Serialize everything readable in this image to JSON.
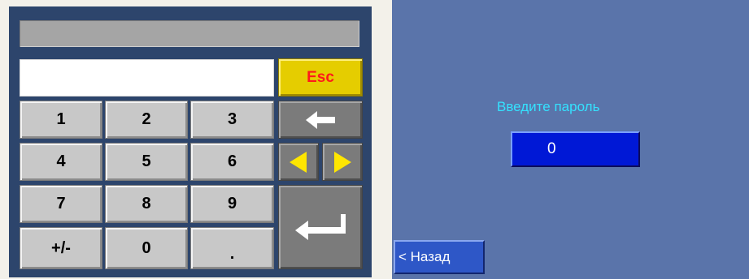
{
  "keypad": {
    "input_value": "",
    "esc_label": "Esc",
    "keys": {
      "k1": "1",
      "k2": "2",
      "k3": "3",
      "k4": "4",
      "k5": "5",
      "k6": "6",
      "k7": "7",
      "k8": "8",
      "k9": "9",
      "plusminus": "+/-",
      "k0": "0",
      "dot": "."
    },
    "icons": {
      "backspace": "arrow-left-icon",
      "cursor_left": "triangle-left-icon",
      "cursor_right": "triangle-right-icon",
      "enter": "enter-return-icon"
    }
  },
  "login": {
    "prompt": "Введите пароль",
    "password_value": "0",
    "back_label": "< Назад"
  },
  "colors": {
    "panel_bg": "#2d456c",
    "key_bg": "#c8c8c8",
    "key_dark_bg": "#7b7b7b",
    "esc_bg": "#e5cd00",
    "esc_text": "#ff1a1a",
    "arrow_yellow": "#ffe600",
    "screen_bg": "#5a74aa",
    "prompt_text": "#34e2ff",
    "password_box_bg": "#0018d6",
    "back_button_bg": "#2e57c7"
  }
}
